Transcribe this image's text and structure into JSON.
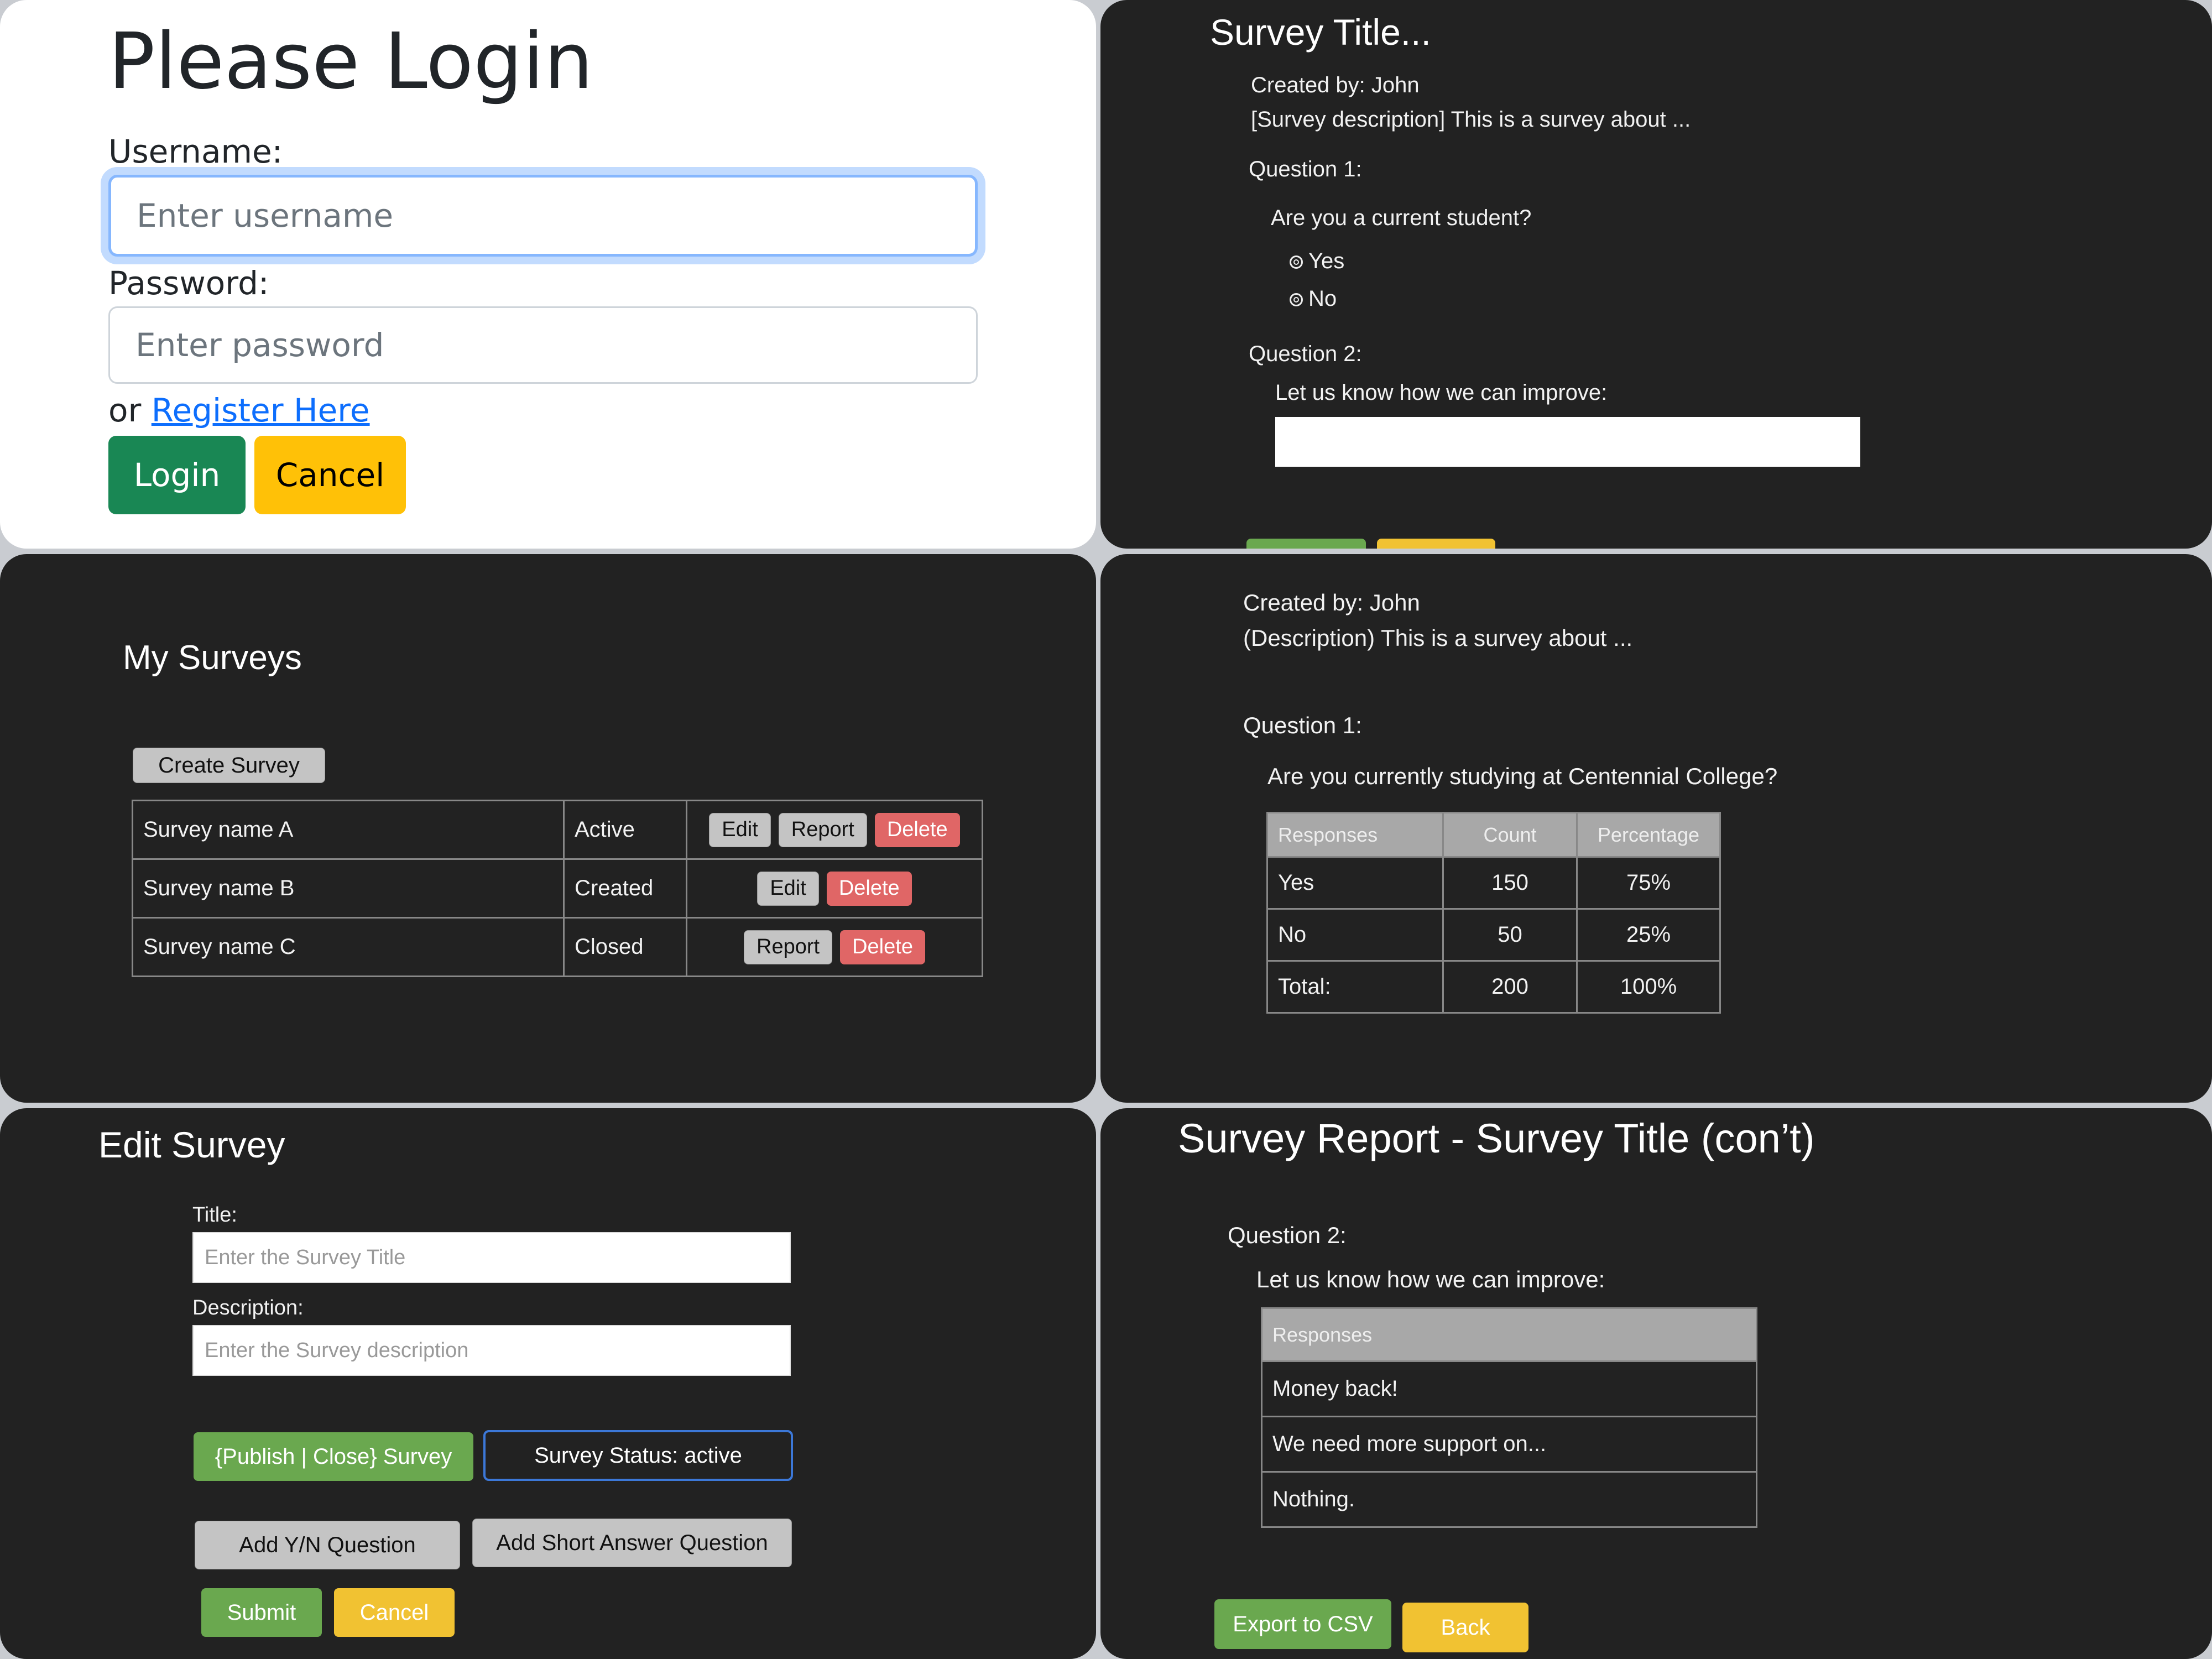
{
  "login": {
    "title": "Please Login",
    "username_label": "Username:",
    "username_placeholder": "Enter username",
    "password_label": "Password:",
    "password_placeholder": "Enter password",
    "or_text": "or",
    "register_link": "Register Here",
    "login_button": "Login",
    "cancel_button": "Cancel",
    "colors": {
      "login_button": "#198754",
      "cancel_button": "#ffc107",
      "link": "#0d6efd"
    }
  },
  "survey_view": {
    "title": "Survey Title...",
    "created_by": "Created by: John",
    "description": "[Survey description] This is a survey about ...",
    "q1_label": "Question 1:",
    "q1_text": "Are you a current student?",
    "q1_options": [
      "Yes",
      "No"
    ],
    "q2_label": "Question 2:",
    "q2_text": "Let us know how we can improve:"
  },
  "my_surveys": {
    "title": "My Surveys",
    "create_button": "Create Survey",
    "rows": [
      {
        "name": "Survey name A",
        "status": "Active",
        "actions": [
          "Edit",
          "Report",
          "Delete"
        ]
      },
      {
        "name": "Survey name B",
        "status": "Created",
        "actions": [
          "Edit",
          "Delete"
        ]
      },
      {
        "name": "Survey name C",
        "status": "Closed",
        "actions": [
          "Report",
          "Delete"
        ]
      }
    ]
  },
  "report_q1": {
    "created_by": "Created by: John",
    "description": "(Description) This is a survey about ...",
    "q_label": "Question 1:",
    "q_text": "Are you currently studying at Centennial College?",
    "headers": [
      "Responses",
      "Count",
      "Percentage"
    ],
    "rows": [
      [
        "Yes",
        "150",
        "75%"
      ],
      [
        "No",
        "50",
        "25%"
      ],
      [
        "Total:",
        "200",
        "100%"
      ]
    ]
  },
  "edit_survey": {
    "title": "Edit Survey",
    "title_label": "Title:",
    "title_placeholder": "Enter the Survey Title",
    "desc_label": "Description:",
    "desc_placeholder": "Enter the Survey description",
    "publish_button": "{Publish | Close} Survey",
    "status_text": "Survey Status: active",
    "add_yn_button": "Add Y/N Question",
    "add_short_button": "Add Short Answer Question",
    "submit_button": "Submit",
    "cancel_button": "Cancel"
  },
  "report_q2": {
    "title": "Survey Report - Survey Title (con’t)",
    "q_label": "Question 2:",
    "q_text": "Let us know how we can improve:",
    "header": "Responses",
    "responses": [
      "Money back!",
      "We need more support on...",
      "Nothing."
    ],
    "export_button": "Export to CSV",
    "back_button": "Back"
  }
}
